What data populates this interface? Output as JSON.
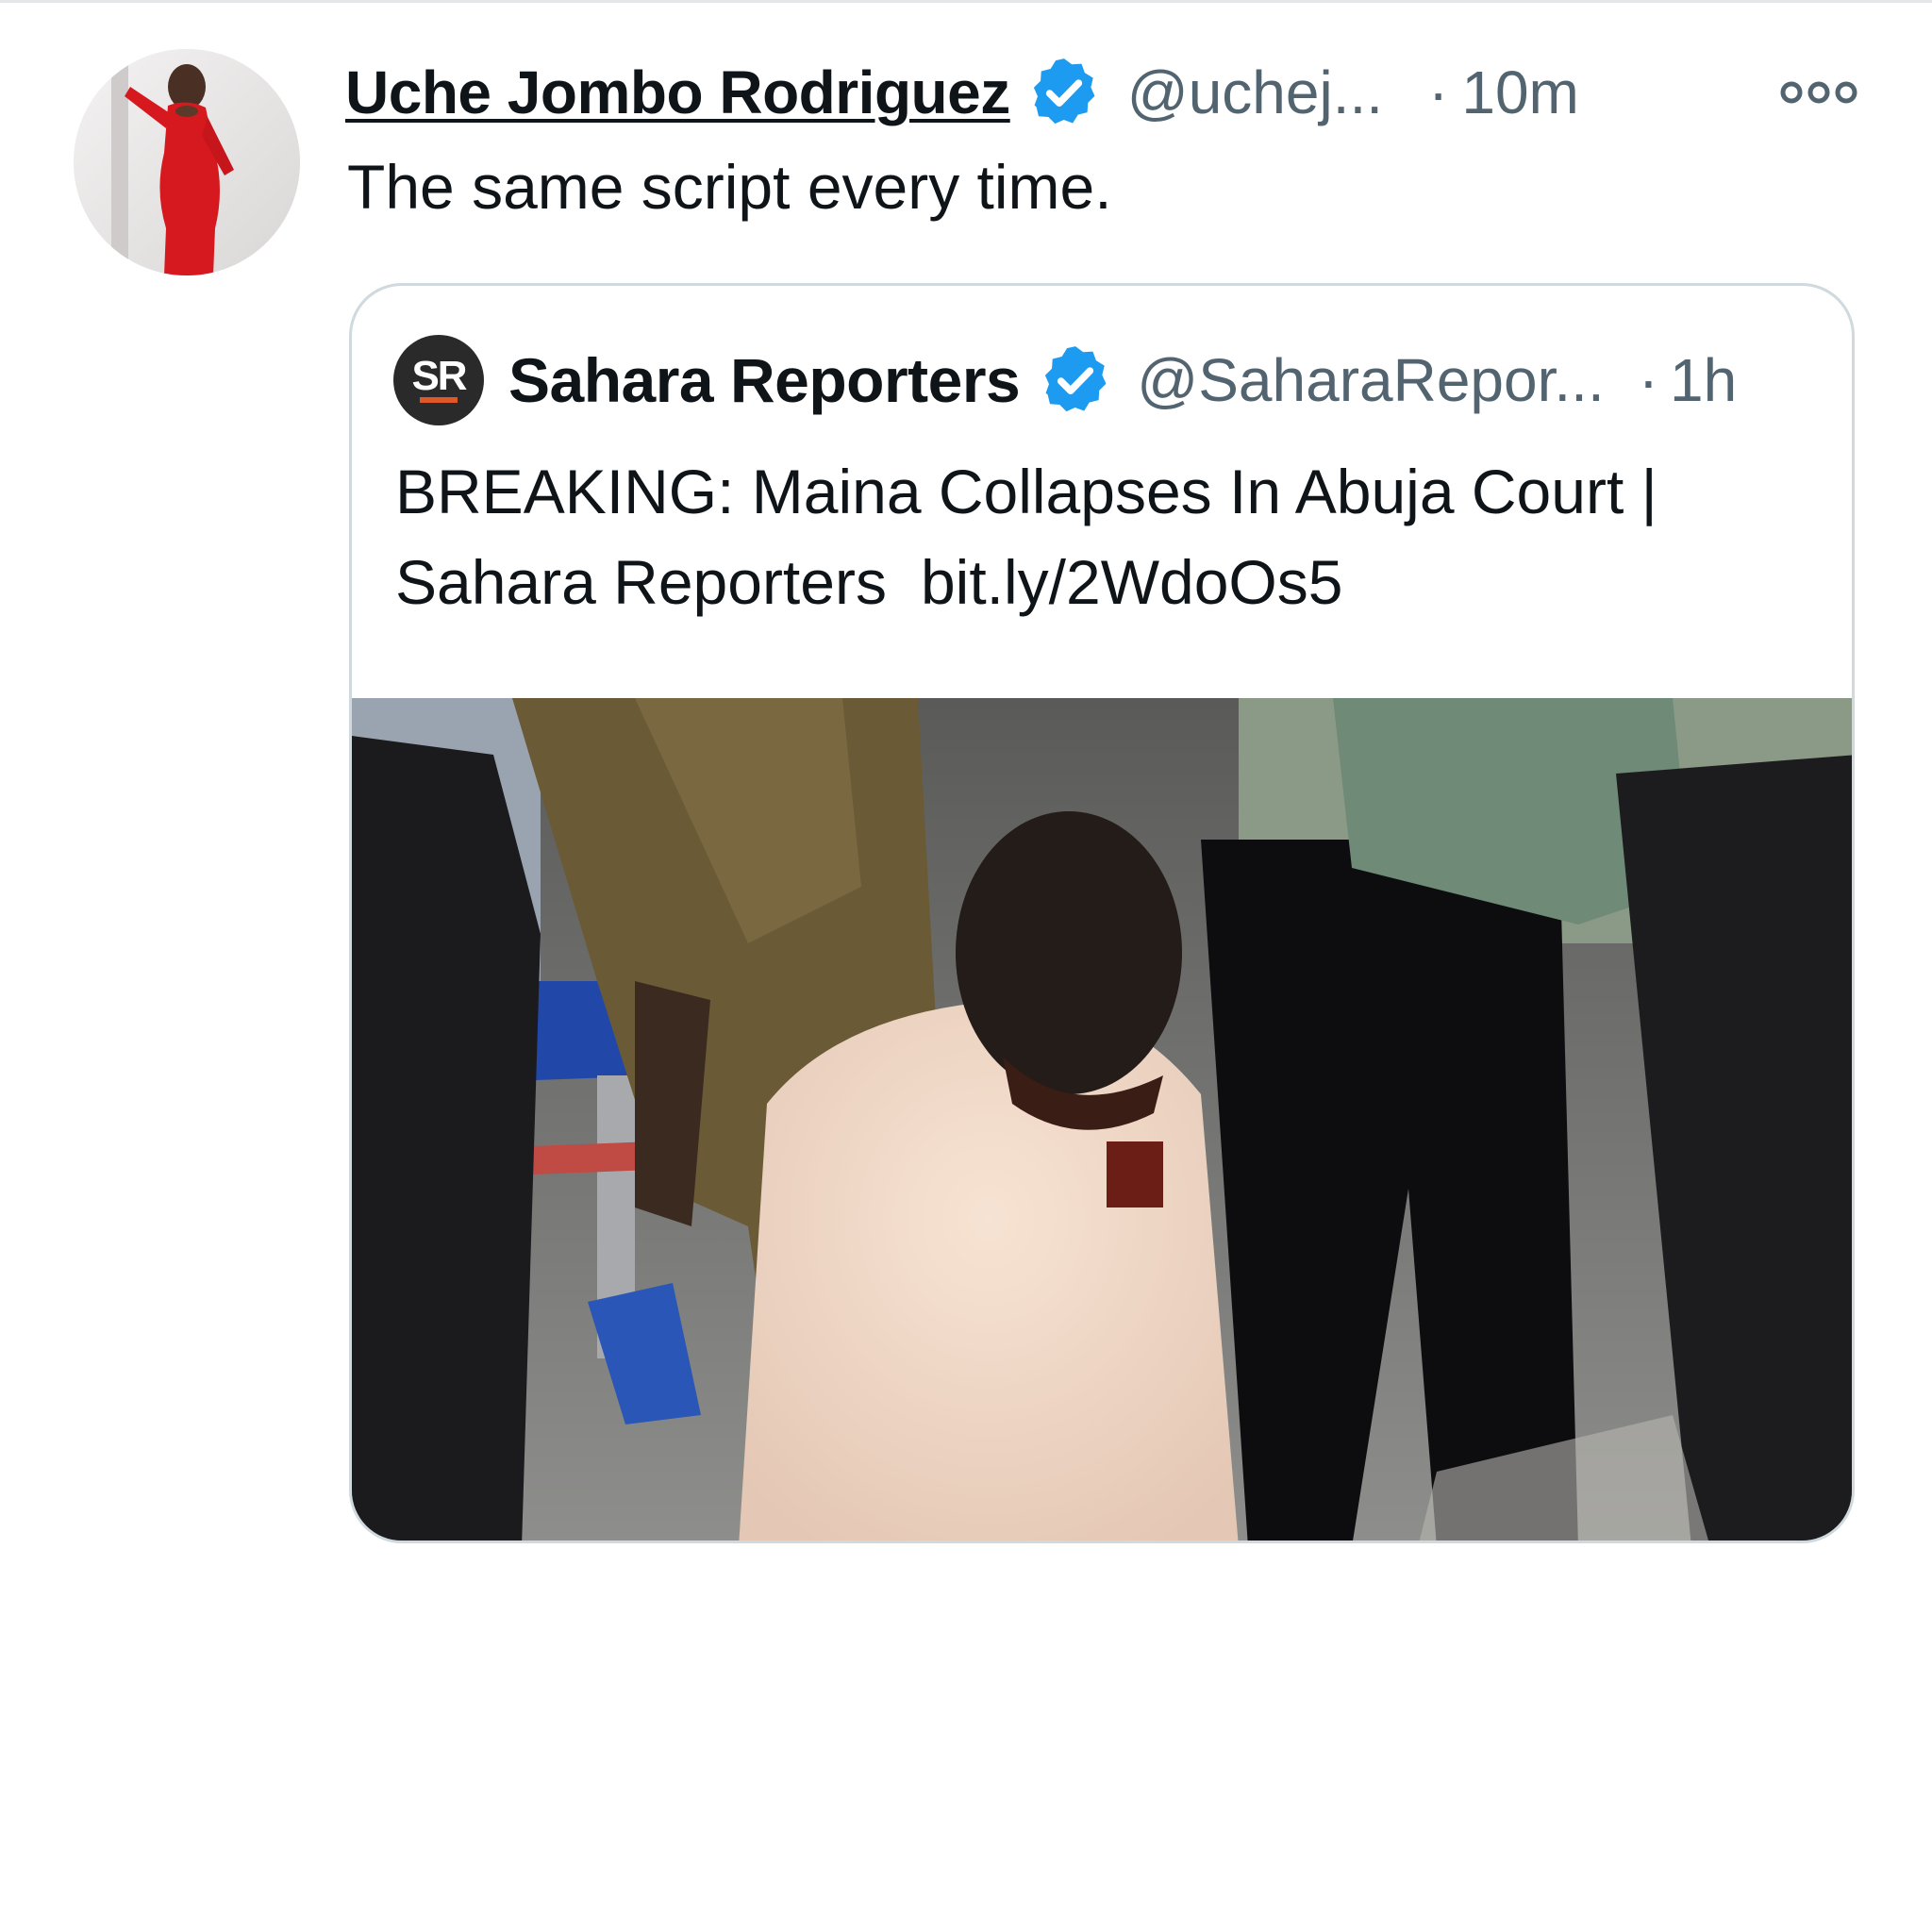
{
  "tweet": {
    "display_name": "Uche Jombo Rodriguez",
    "handle": "@uchej...",
    "separator": "·",
    "time": "10m",
    "more_icon": "more-options-icon",
    "text": "The same script every time.",
    "verified_color": "#1d9bf0"
  },
  "quoted_tweet": {
    "avatar_initials": "SR",
    "display_name": "Sahara Reporters",
    "handle": "@SaharaRepor...",
    "separator": "·",
    "time": "1h",
    "text_line1": "BREAKING: Maina Collapses In Abuja Court |",
    "text_line2": "Sahara Reporters",
    "link": "bit.ly/2WdoOs5"
  }
}
